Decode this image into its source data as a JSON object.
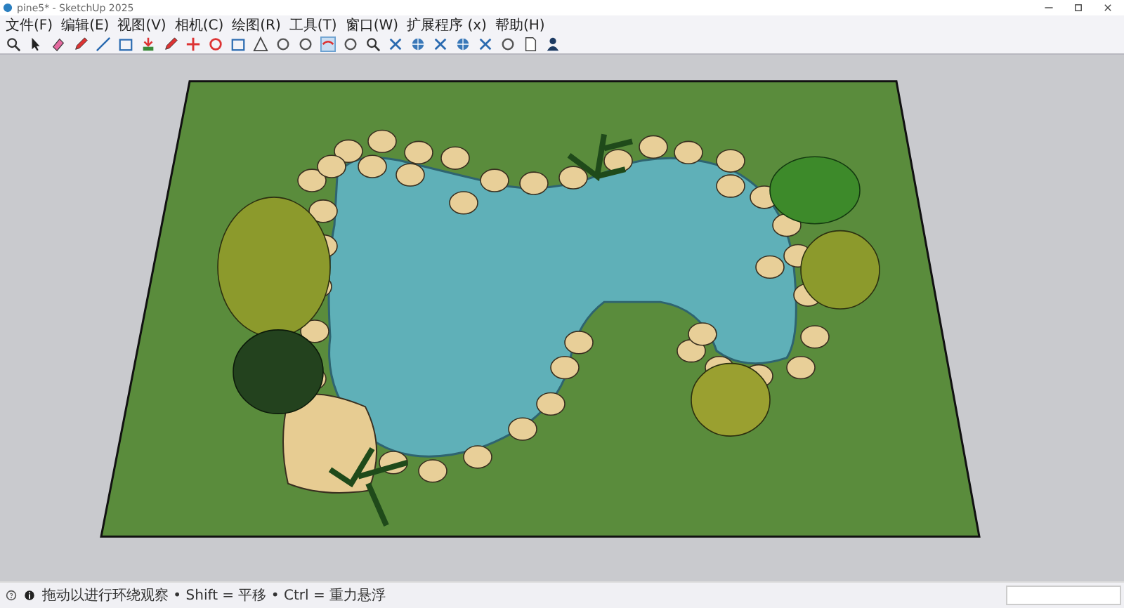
{
  "window": {
    "title": "pine5* - SketchUp 2025"
  },
  "menu": [
    "文件(F)",
    "编辑(E)",
    "视图(V)",
    "相机(C)",
    "绘图(R)",
    "工具(T)",
    "窗口(W)",
    "扩展程序 (x)",
    "帮助(H)"
  ],
  "status_bar": {
    "hint": "拖动以进行环绕观察 • Shift = 平移 • Ctrl = 重力悬浮"
  }
}
